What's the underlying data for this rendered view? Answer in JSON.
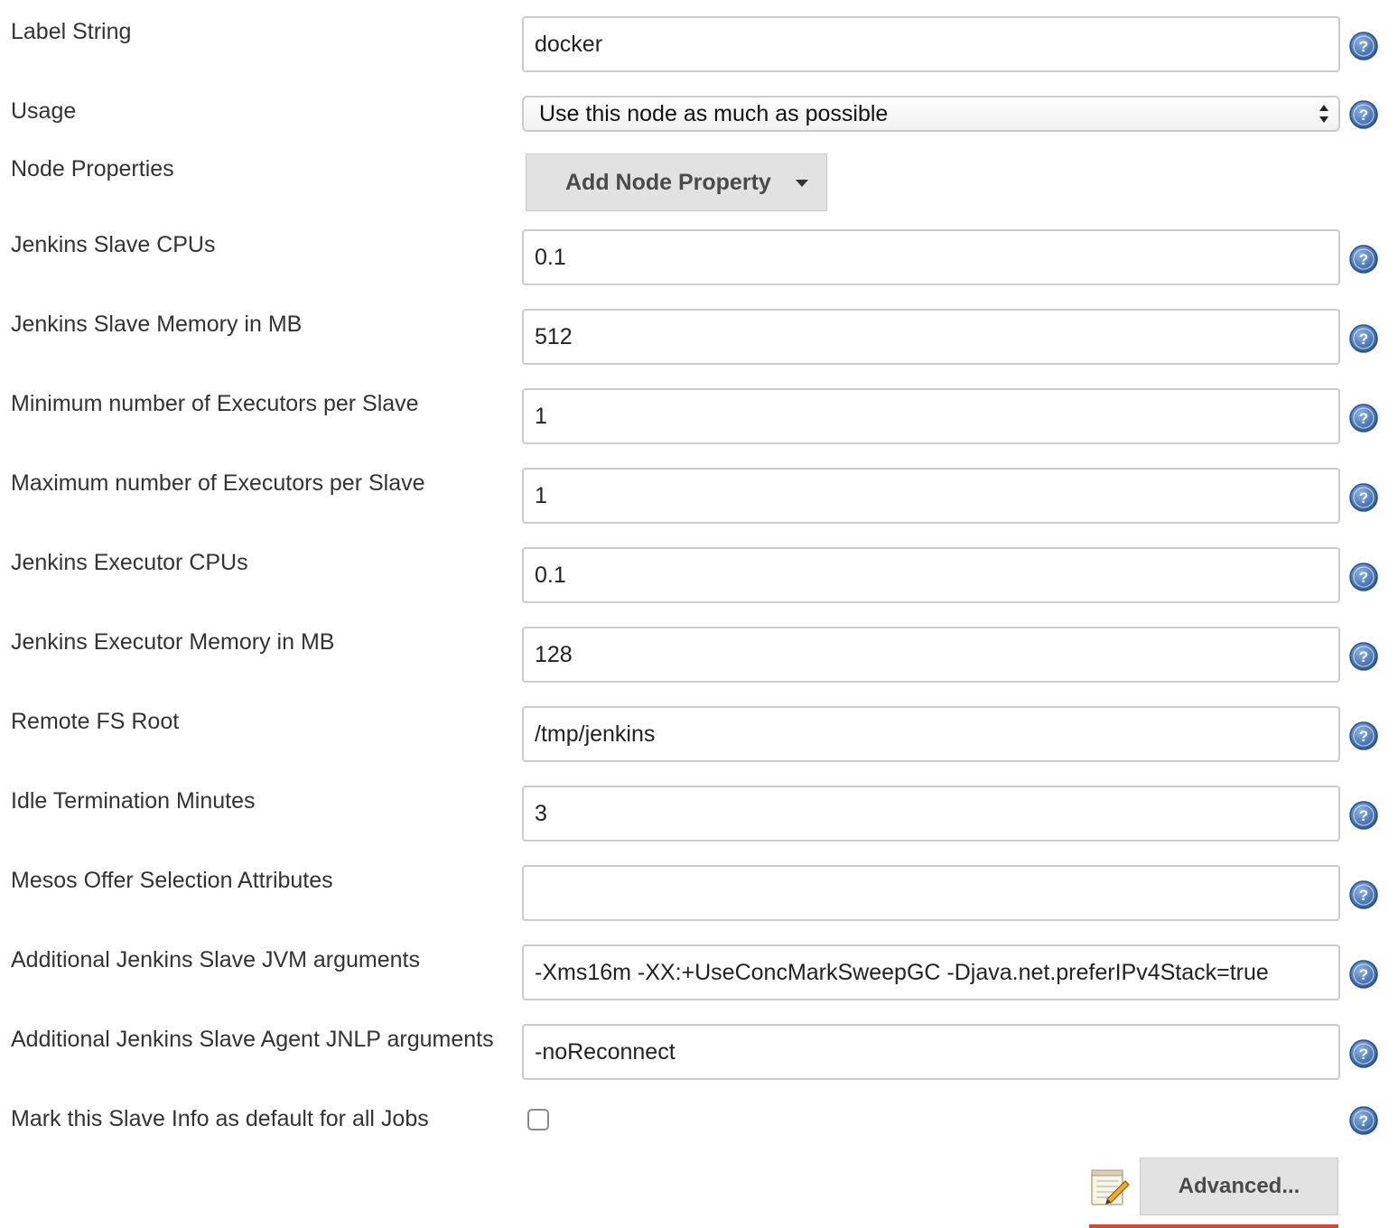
{
  "fields": {
    "label_string": {
      "label": "Label String",
      "value": "docker"
    },
    "usage": {
      "label": "Usage",
      "selected": "Use this node as much as possible"
    },
    "node_properties": {
      "label": "Node Properties",
      "button_label": "Add Node Property"
    },
    "slave_cpus": {
      "label": "Jenkins Slave CPUs",
      "value": "0.1"
    },
    "slave_memory": {
      "label": "Jenkins Slave Memory in MB",
      "value": "512"
    },
    "min_executors": {
      "label": "Minimum number of Executors per Slave",
      "value": "1"
    },
    "max_executors": {
      "label": "Maximum number of Executors per Slave",
      "value": "1"
    },
    "executor_cpus": {
      "label": "Jenkins Executor CPUs",
      "value": "0.1"
    },
    "executor_memory": {
      "label": "Jenkins Executor Memory in MB",
      "value": "128"
    },
    "remote_fs_root": {
      "label": "Remote FS Root",
      "value": "/tmp/jenkins"
    },
    "idle_termination": {
      "label": "Idle Termination Minutes",
      "value": "3"
    },
    "mesos_offer_attributes": {
      "label": "Mesos Offer Selection Attributes",
      "value": ""
    },
    "jvm_args": {
      "label": "Additional Jenkins Slave JVM arguments",
      "value": "-Xms16m -XX:+UseConcMarkSweepGC -Djava.net.preferIPv4Stack=true"
    },
    "jnlp_args": {
      "label": "Additional Jenkins Slave Agent JNLP arguments",
      "value": "-noReconnect"
    },
    "default_slave": {
      "label": "Mark this Slave Info as default for all Jobs",
      "checked": false
    }
  },
  "actions": {
    "advanced_label": "Advanced..."
  },
  "icons": {
    "help": "help-icon",
    "notepad": "notepad-icon",
    "dropdown_caret": "chevron-down-icon"
  },
  "colors": {
    "help_icon": "#3e6fb0",
    "button_bg": "#e2e2e2",
    "accent_red": "#d24939"
  }
}
